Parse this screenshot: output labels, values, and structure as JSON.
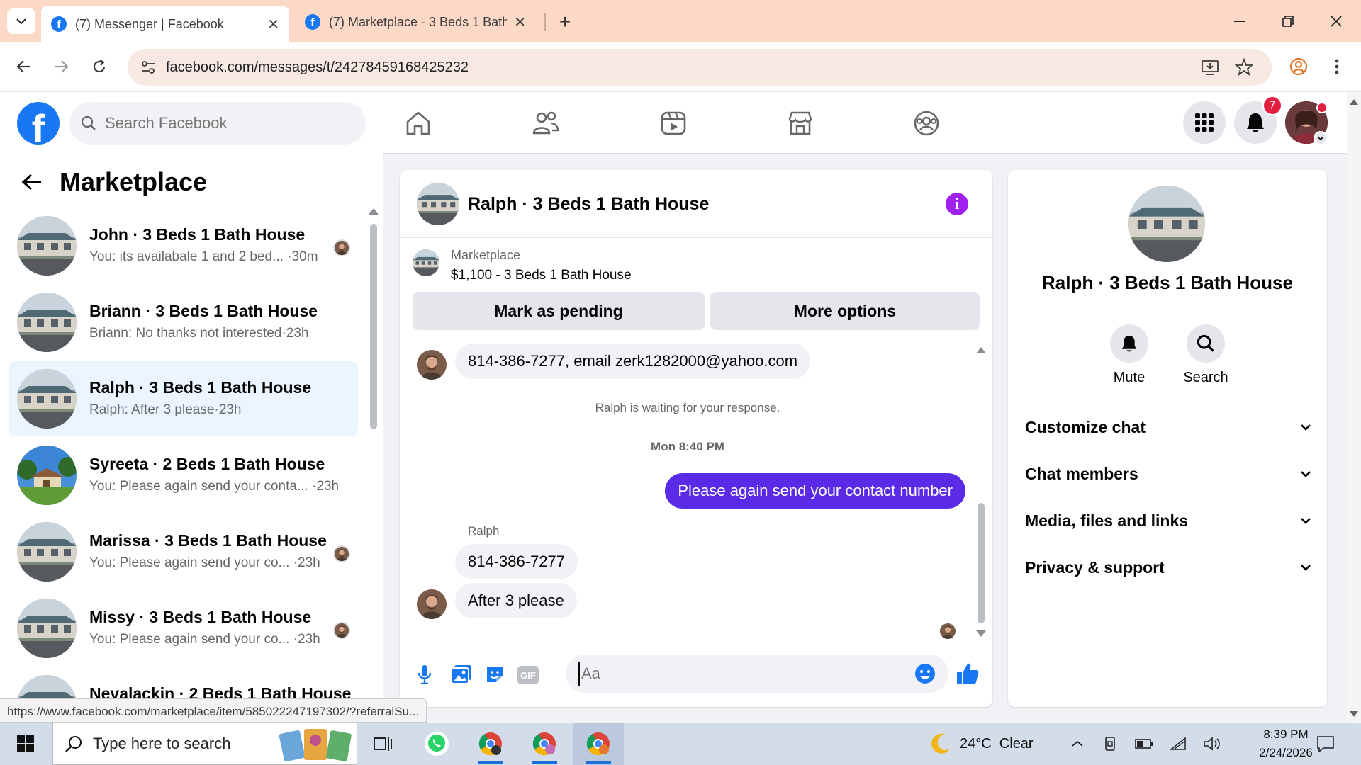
{
  "browser": {
    "tabs": [
      {
        "title": "(7) Messenger | Facebook",
        "active": true
      },
      {
        "title": "(7) Marketplace - 3 Beds 1 Bath",
        "active": false
      }
    ],
    "url": "facebook.com/messages/t/24278459168425232",
    "status_url": "https://www.facebook.com/marketplace/item/585022247197302/?referralSu..."
  },
  "fb": {
    "logo_letter": "f",
    "search_placeholder": "Search Facebook",
    "notification_count": "7"
  },
  "sidebar": {
    "title": "Marketplace",
    "conversations": [
      {
        "name": "John · 3 Beds 1 Bath House",
        "preview": "You: its availabale 1 and 2 bed... ·30m",
        "selected": false,
        "seen": true,
        "thumb": "house"
      },
      {
        "name": "Briann · 3 Beds 1 Bath House",
        "preview": "Briann: No thanks not interested·23h",
        "selected": false,
        "seen": false,
        "thumb": "house"
      },
      {
        "name": "Ralph · 3 Beds 1 Bath House",
        "preview": "Ralph: After 3 please·23h",
        "selected": true,
        "seen": false,
        "thumb": "house"
      },
      {
        "name": "Syreeta · 2 Beds 1 Bath House",
        "preview": "You: Please again send your conta... ·23h",
        "selected": false,
        "seen": false,
        "thumb": "yard"
      },
      {
        "name": "Marissa · 3 Beds 1 Bath House",
        "preview": "You: Please again send your co... ·23h",
        "selected": false,
        "seen": true,
        "thumb": "house"
      },
      {
        "name": "Missy · 3 Beds 1 Bath House",
        "preview": "You: Please again send your co... ·23h",
        "selected": false,
        "seen": true,
        "thumb": "house"
      },
      {
        "name": "Nevalackin · 2 Beds 1 Bath House",
        "preview": "",
        "selected": false,
        "seen": false,
        "thumb": "house"
      }
    ]
  },
  "chat": {
    "title": "Ralph · 3 Beds 1 Bath House",
    "listing_source": "Marketplace",
    "listing_price": "$1,100 - 3 Beds 1 Bath House",
    "mark_pending_label": "Mark as pending",
    "more_options_label": "More options",
    "messages": {
      "m1": "814-386-7277, email zerk1282000@yahoo.com",
      "waiting": "Ralph is waiting for your response.",
      "timestamp": "Mon 8:40 PM",
      "out1": "Please again send your contact number",
      "sender": "Ralph",
      "m2": "814-386-7277",
      "m3": "After 3 please"
    },
    "composer_placeholder": "Aa",
    "colors": {
      "outgoing": "#5b2ae6",
      "accent": "#1877f2",
      "info": "#a020f0"
    }
  },
  "info": {
    "name": "Ralph · 3 Beds 1 Bath House",
    "mute_label": "Mute",
    "search_label": "Search",
    "sections": [
      "Customize chat",
      "Chat members",
      "Media, files and links",
      "Privacy & support"
    ]
  },
  "taskbar": {
    "search_placeholder": "Type here to search",
    "weather": "24°C  Clear",
    "time": "8:39 PM",
    "date": "2/24/2026"
  }
}
